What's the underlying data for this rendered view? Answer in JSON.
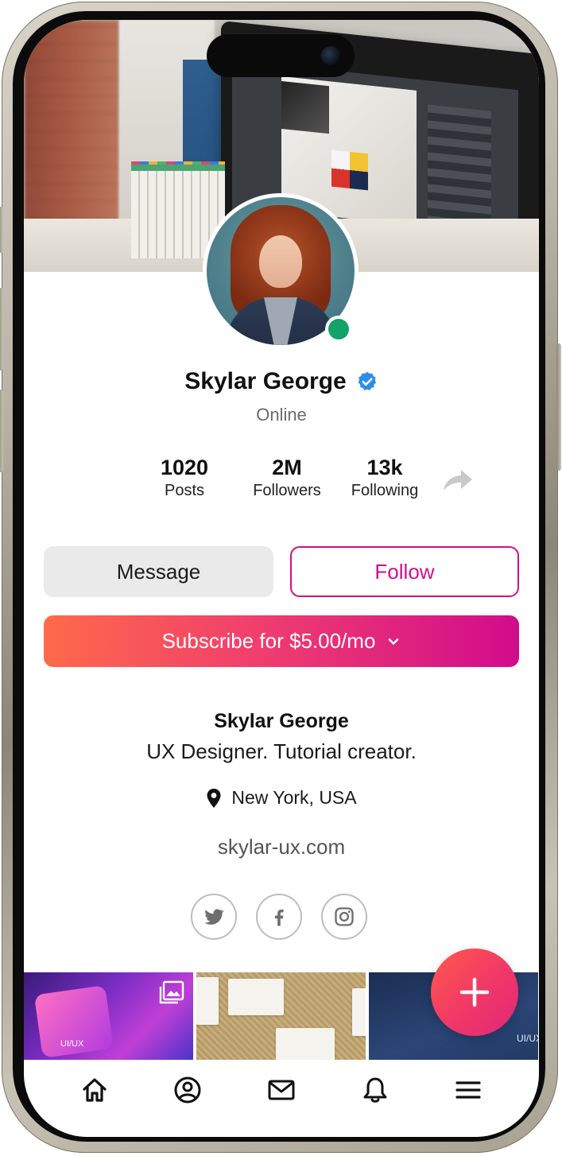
{
  "profile": {
    "name": "Skylar George",
    "status": "Online",
    "verified": true
  },
  "stats": [
    {
      "value": "1020",
      "label": "Posts"
    },
    {
      "value": "2M",
      "label": "Followers"
    },
    {
      "value": "13k",
      "label": "Following"
    }
  ],
  "actions": {
    "message_label": "Message",
    "follow_label": "Follow",
    "subscribe_label": "Subscribe for $5.00/mo"
  },
  "bio": {
    "name": "Skylar George",
    "description": "UX Designer. Tutorial creator.",
    "location": "New York, USA",
    "website": "skylar-ux.com"
  },
  "socials": [
    {
      "icon": "twitter-icon"
    },
    {
      "icon": "facebook-icon"
    },
    {
      "icon": "instagram-icon"
    }
  ],
  "gallery": {
    "thumb_1_label": "UI/UX",
    "thumb_3_label": "UI/UX"
  },
  "nav": [
    {
      "icon": "home-icon"
    },
    {
      "icon": "profile-icon"
    },
    {
      "icon": "mail-icon"
    },
    {
      "icon": "bell-icon"
    },
    {
      "icon": "menu-icon"
    }
  ],
  "colors": {
    "accent": "#d10f8c",
    "gradient_start": "#ff6a4a",
    "gradient_end": "#d10c8c",
    "online": "#11a36a",
    "verified": "#2f8de8"
  }
}
